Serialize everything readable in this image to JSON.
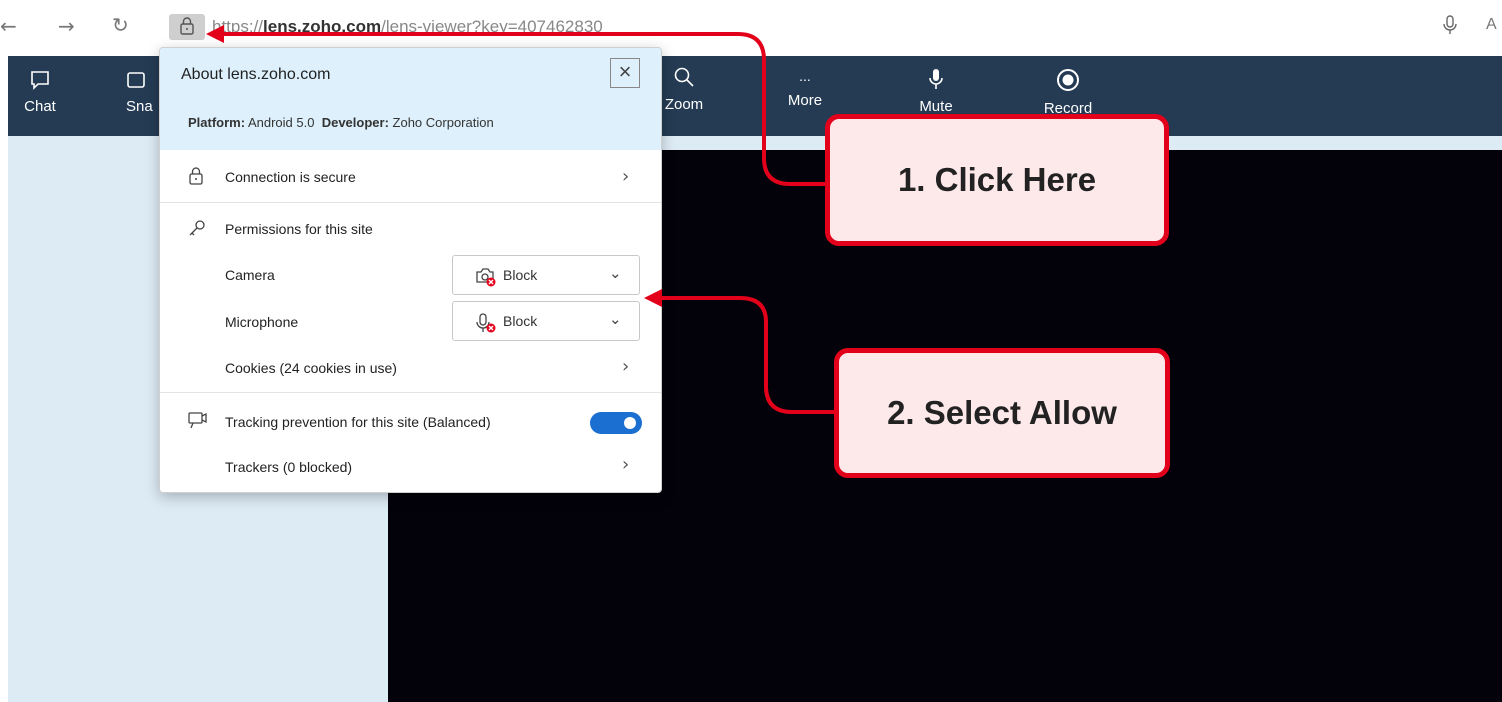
{
  "browser": {
    "url_domain": "lens.zoho.com",
    "url_prefix": "https://",
    "url_path": "/lens-viewer?key=407462830"
  },
  "toolbar": {
    "items": [
      {
        "label": "Chat",
        "icon": "chat-bubble-icon"
      },
      {
        "label": "Sna",
        "icon": "snapshot-icon"
      },
      {
        "label": "Zoom",
        "icon": "zoom-icon"
      },
      {
        "label": "More",
        "icon": "more-dots-icon",
        "glyph": "..."
      },
      {
        "label": "Mute",
        "icon": "microphone-icon"
      },
      {
        "label": "Record",
        "icon": "record-icon"
      }
    ]
  },
  "popup": {
    "title": "About lens.zoho.com",
    "platform_label": "Platform:",
    "platform_value": "Android 5.0",
    "developer_label": "Developer:",
    "developer_value": "Zoho Corporation",
    "close_glyph": "×",
    "connection": "Connection is secure",
    "permissions": "Permissions for this site",
    "camera_label": "Camera",
    "camera_value": "Block",
    "microphone_label": "Microphone",
    "microphone_value": "Block",
    "cookies": "Cookies (24 cookies in use)",
    "tracking": "Tracking prevention for this site (Balanced)",
    "tracking_enabled": true,
    "trackers": "Trackers (0 blocked)"
  },
  "callouts": {
    "step1": "1. Click Here",
    "step2": "2. Select Allow"
  },
  "colors": {
    "toolbar_bg": "#243b53",
    "popup_header_bg": "#ddf0fb",
    "callout_border": "#e3001b",
    "callout_fill": "#fde8ea",
    "toggle_on": "#1a6fd1"
  }
}
